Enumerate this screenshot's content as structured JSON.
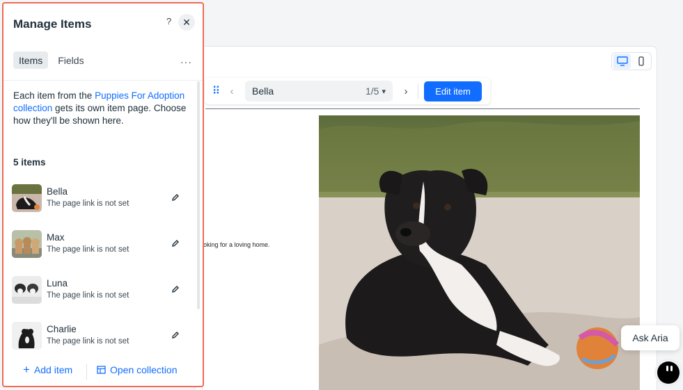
{
  "panel": {
    "title": "Manage Items",
    "help": "?",
    "close": "✕",
    "tabs": [
      {
        "label": "Items"
      },
      {
        "label": "Fields"
      }
    ],
    "more": "···",
    "description": {
      "before": "Each item from the",
      "link": "Puppies For Adoption collection",
      "after": "gets its own item page. Choose how they'll be shown here."
    },
    "count_label": "5 items",
    "items": [
      {
        "name": "Bella",
        "status": "The page link is not set"
      },
      {
        "name": "Max",
        "status": "The page link is not set"
      },
      {
        "name": "Luna",
        "status": "The page link is not set"
      },
      {
        "name": "Charlie",
        "status": "The page link is not set"
      }
    ],
    "footer": {
      "add_item": "Add item",
      "open_collection": "Open collection"
    }
  },
  "toolbar": {
    "current_item": "Bella",
    "position": "1/5",
    "edit_button": "Edit item"
  },
  "canvas": {
    "body_text": "oking for a loving home."
  },
  "aria": {
    "label": "Ask Aria"
  },
  "colors": {
    "accent": "#116dff",
    "highlight_border": "#ef6b55"
  }
}
